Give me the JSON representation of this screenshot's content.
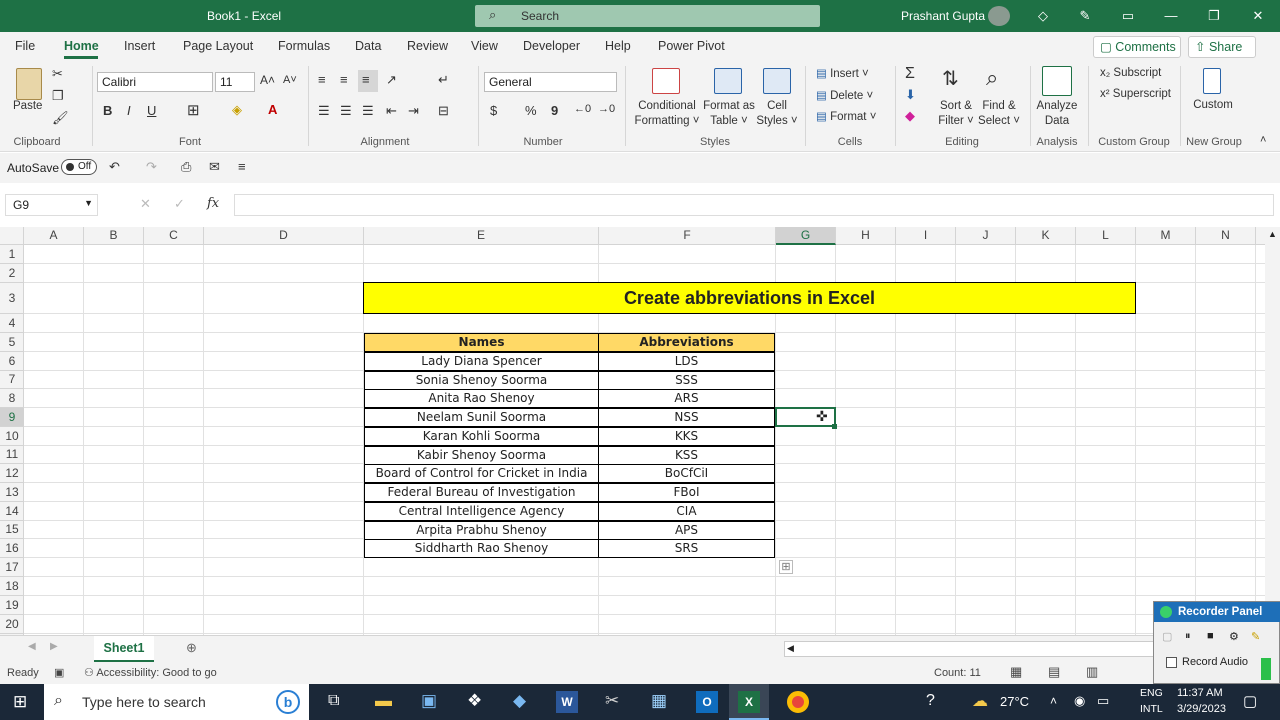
{
  "titlebar": {
    "title": "Book1  -  Excel",
    "search_placeholder": "Search",
    "user_name": "Prashant Gupta"
  },
  "menu": {
    "tabs": [
      "File",
      "Home",
      "Insert",
      "Page Layout",
      "Formulas",
      "Data",
      "Review",
      "View",
      "Developer",
      "Help",
      "Power Pivot"
    ],
    "comments": "Comments",
    "share": "Share"
  },
  "ribbon": {
    "clipboard": {
      "paste": "Paste",
      "group": "Clipboard"
    },
    "font": {
      "name": "Calibri",
      "size": "11",
      "group": "Font",
      "bold": "B",
      "italic": "I",
      "underline": "U"
    },
    "alignment": {
      "group": "Alignment"
    },
    "number": {
      "format": "General",
      "group": "Number",
      "currency": "$",
      "percent": "%",
      "comma": "9"
    },
    "styles": {
      "conditional1": "Conditional",
      "conditional2": "Formatting",
      "format_table1": "Format as",
      "format_table2": "Table",
      "cell_styles1": "Cell",
      "cell_styles2": "Styles",
      "group": "Styles"
    },
    "cells": {
      "insert": "Insert",
      "delete": "Delete",
      "format": "Format",
      "group": "Cells"
    },
    "editing": {
      "sort1": "Sort &",
      "sort2": "Filter",
      "find1": "Find &",
      "find2": "Select",
      "group": "Editing"
    },
    "analysis": {
      "analyze1": "Analyze",
      "analyze2": "Data",
      "group": "Analysis"
    },
    "custom_group": {
      "subscript": "Subscript",
      "superscript": "Superscript",
      "group": "Custom Group"
    },
    "new_group": {
      "custom": "Custom",
      "group": "New Group"
    }
  },
  "qat": {
    "autosave": "AutoSave",
    "toggle": "Off"
  },
  "formula_bar": {
    "name_box": "G9",
    "fx": "fx",
    "value": ""
  },
  "columns": [
    "A",
    "B",
    "C",
    "D",
    "E",
    "F",
    "G",
    "H",
    "I",
    "J",
    "K",
    "L",
    "M",
    "N"
  ],
  "rows": [
    "1",
    "2",
    "3",
    "4",
    "5",
    "6",
    "7",
    "8",
    "9",
    "10",
    "11",
    "12",
    "13",
    "14",
    "15",
    "16",
    "17",
    "18",
    "19",
    "20"
  ],
  "sheet": {
    "title": "Create abbreviations in Excel",
    "header": {
      "names": "Names",
      "abbr": "Abbreviations"
    },
    "rows": [
      {
        "name": "Lady Diana Spencer",
        "abbr": "LDS"
      },
      {
        "name": "Sonia Shenoy Soorma",
        "abbr": "SSS"
      },
      {
        "name": "Anita Rao Shenoy",
        "abbr": "ARS"
      },
      {
        "name": "Neelam Sunil Soorma",
        "abbr": "NSS"
      },
      {
        "name": "Karan Kohli Soorma",
        "abbr": "KKS"
      },
      {
        "name": "Kabir Shenoy Soorma",
        "abbr": "KSS"
      },
      {
        "name": "Board of Control for Cricket in India",
        "abbr": "BoCfCiI"
      },
      {
        "name": "Federal Bureau of Investigation",
        "abbr": "FBoI"
      },
      {
        "name": "Central Intelligence Agency",
        "abbr": "CIA"
      },
      {
        "name": "Arpita Prabhu Shenoy",
        "abbr": "APS"
      },
      {
        "name": "Siddharth Rao Shenoy",
        "abbr": "SRS"
      }
    ]
  },
  "sheet_tab": "Sheet1",
  "status": {
    "ready": "Ready",
    "accessibility": "Accessibility: Good to go",
    "count": "Count: 11"
  },
  "taskbar": {
    "search": "Type here to search",
    "temp": "27°C",
    "lang1": "ENG",
    "lang2": "INTL",
    "time": "11:37 AM",
    "date": "3/29/2023"
  },
  "recorder": {
    "title": "Recorder Panel",
    "record_audio": "Record Audio"
  },
  "colors": {
    "excel_green": "#1e7145",
    "title_fill": "#ffff00",
    "header_fill": "#ffd966"
  }
}
